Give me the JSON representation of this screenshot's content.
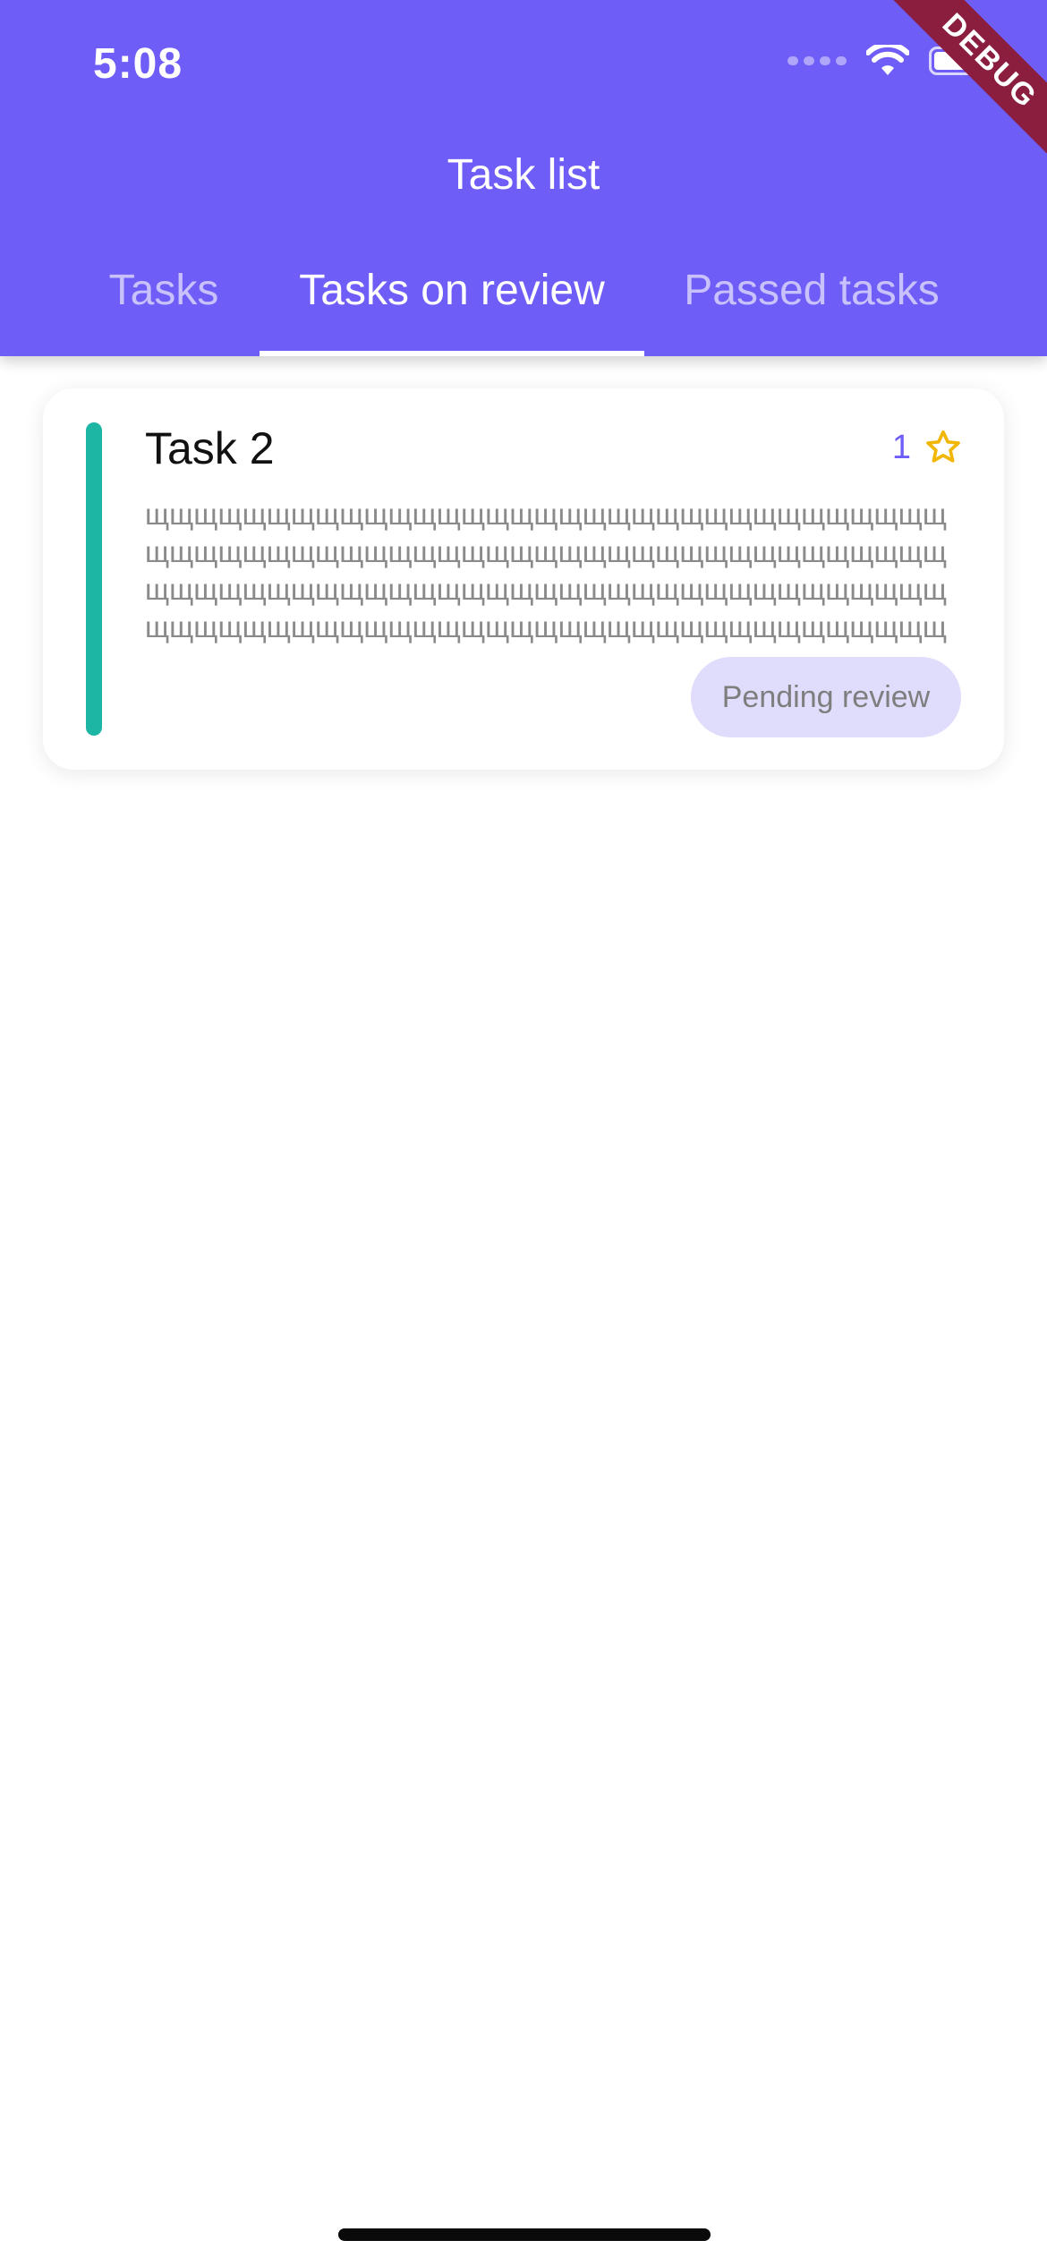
{
  "status_bar": {
    "time": "5:08",
    "debug_label": "DEBUG"
  },
  "app_bar": {
    "title": "Task list",
    "tabs": [
      {
        "label": "Tasks",
        "active": false
      },
      {
        "label": "Tasks on review",
        "active": true
      },
      {
        "label": "Passed tasks",
        "active": false
      }
    ]
  },
  "tasks": [
    {
      "title": "Task 2",
      "rating": "1",
      "rating_icon": "star-outline-icon",
      "description": "щщщщщщщщщщщщщщщщщщщщщщщщщщщщщщщщщщщщщщщщщщщщщщщщщщщщщщщщщщщщщщщщщщщщщщщщщщщщщщщщщщщщщщщщщщщщщщщщщщщщщщщщщщщщщщщщщщщщщщщщщщщщщщщщщщщщщщщщщщщщщщщщщщщщщщщщщщщщщ",
      "status": "Pending review",
      "accent_color": "#1DB5A3"
    }
  ],
  "colors": {
    "primary": "#6E5DF6",
    "star": "#F2B705",
    "pill_bg": "#E0DCFC",
    "debug_ribbon": "#8B1E3F"
  }
}
